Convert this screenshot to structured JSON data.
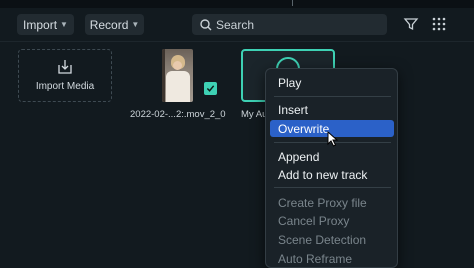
{
  "toolbar": {
    "import_label": "Import",
    "record_label": "Record",
    "search_placeholder": "Search"
  },
  "media": {
    "import_card_label": "Import Media",
    "video_label": "2022-02-...2:.mov_2_0",
    "audio_label": "My Au"
  },
  "context_menu": {
    "items": [
      {
        "label": "Play",
        "enabled": true,
        "active": false
      },
      {
        "label": "Insert",
        "enabled": true,
        "active": false
      },
      {
        "label": "Overwrite",
        "enabled": true,
        "active": true
      },
      {
        "label": "Append",
        "enabled": true,
        "active": false
      },
      {
        "label": "Add to new track",
        "enabled": true,
        "active": false
      },
      {
        "label": "Create Proxy file",
        "enabled": false,
        "active": false
      },
      {
        "label": "Cancel Proxy",
        "enabled": false,
        "active": false
      },
      {
        "label": "Scene Detection",
        "enabled": false,
        "active": false
      },
      {
        "label": "Auto Reframe",
        "enabled": false,
        "active": false
      }
    ]
  },
  "colors": {
    "accent": "#3ed1b4",
    "menu_highlight": "#2b61c8",
    "background": "#121a1f"
  },
  "icons": [
    "search-icon",
    "filter-icon",
    "grid-icon",
    "import-icon",
    "checkmark-icon",
    "audio-disc-icon",
    "chevron-down-icon",
    "cursor-icon"
  ]
}
